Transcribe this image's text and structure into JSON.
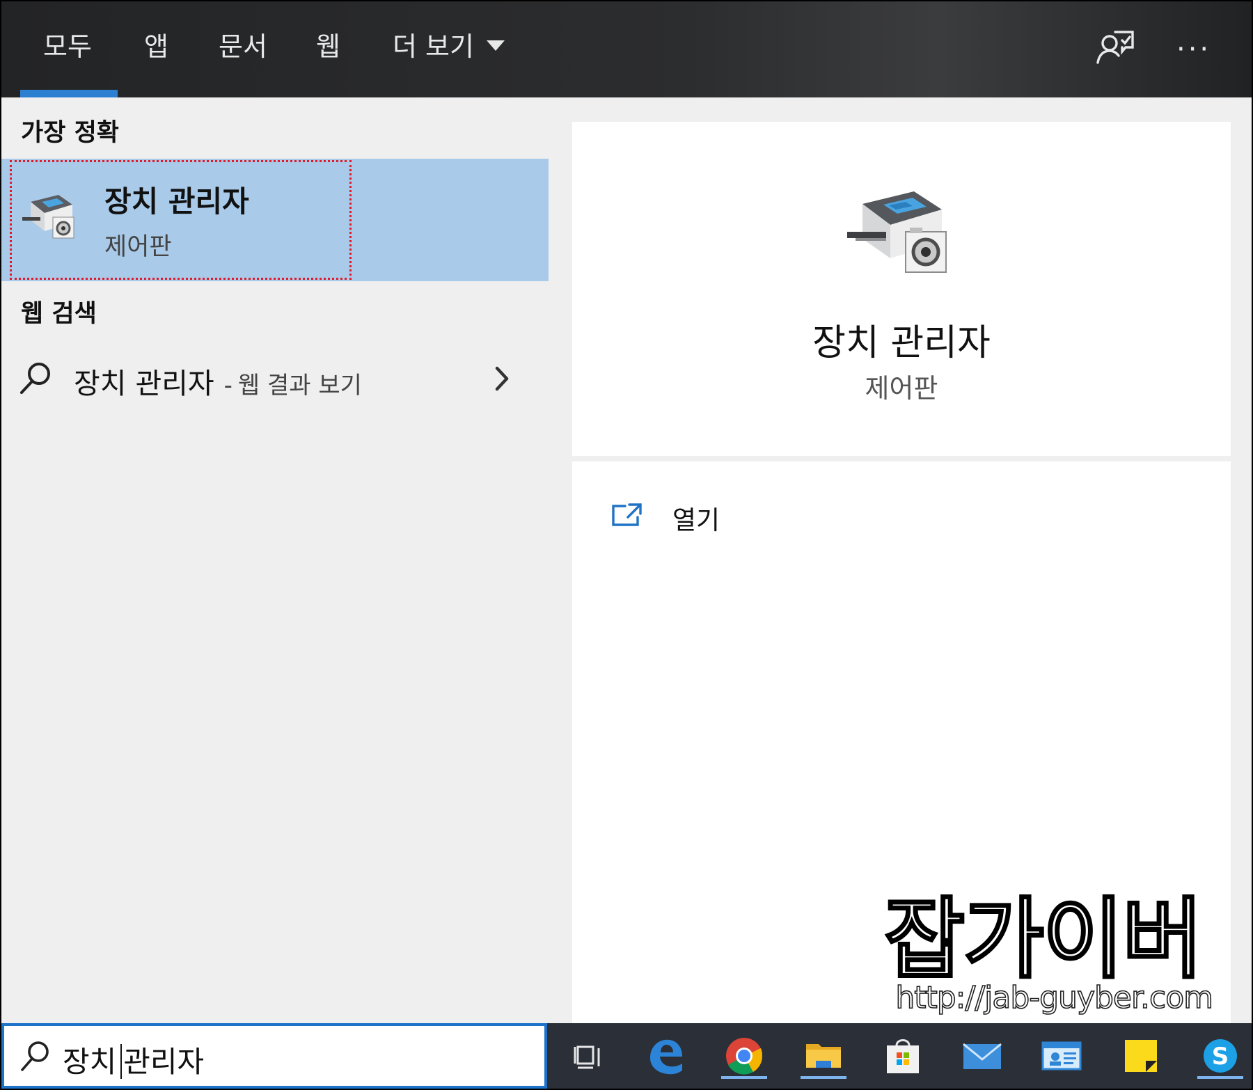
{
  "tabs": [
    {
      "label": "모두",
      "active": true
    },
    {
      "label": "앱"
    },
    {
      "label": "문서"
    },
    {
      "label": "웹"
    },
    {
      "label": "더 보기"
    }
  ],
  "toolbar": {
    "feedback_icon": "feedback-person-icon",
    "more_icon": "ellipsis-icon",
    "more_label": "···"
  },
  "best_match": {
    "heading": "가장 정확",
    "title": "장치 관리자",
    "subtitle": "제어판",
    "icon": "device-manager-icon"
  },
  "web_search": {
    "heading": "웹 검색",
    "query": "장치 관리자",
    "dash": "-",
    "hint": "웹 결과 보기",
    "icon": "search-icon"
  },
  "preview": {
    "title": "장치 관리자",
    "subtitle": "제어판",
    "actions": [
      {
        "label": "열기",
        "icon": "open-external-icon"
      }
    ]
  },
  "watermark": {
    "name": "잡가이버",
    "url": "http://jab-guyber.com"
  },
  "search_box": {
    "before_cursor": "장치",
    "after_cursor": "관리자"
  },
  "taskbar": {
    "items": [
      "task-view-icon",
      "edge-icon",
      "chrome-icon",
      "file-explorer-icon",
      "store-icon",
      "mail-icon",
      "contacts-icon",
      "sticky-notes-icon",
      "skype-icon"
    ],
    "skype_letter": "S"
  },
  "colors": {
    "accent": "#2d7fd1",
    "selection": "#a9cbe9",
    "highlight_border": "#e0192b"
  }
}
